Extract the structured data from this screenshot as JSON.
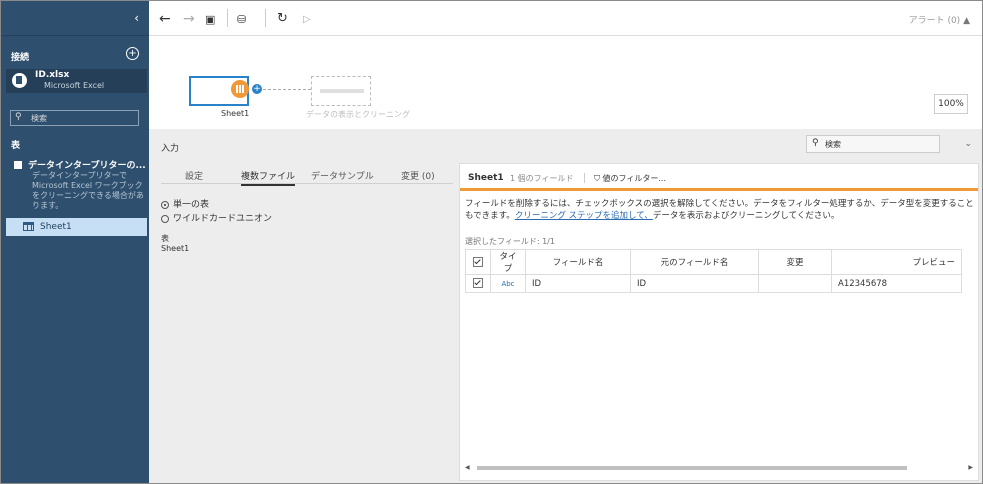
{
  "sidebar": {
    "collapse_glyph": "‹",
    "connections_label": "接続",
    "connection": {
      "name": "ID.xlsx",
      "type": "Microsoft Excel"
    },
    "search_placeholder": "検索",
    "tables_label": "表",
    "data_interpreter": {
      "label": "データインタープリターの...",
      "description": "データインタープリターで Microsoft Excel ワークブックをクリーニングできる場合があります。"
    },
    "sheet_item": "Sheet1"
  },
  "toolbar": {
    "alert": "アラート (0)"
  },
  "canvas": {
    "node_label": "Sheet1",
    "ghost_label": "データの表示とクリーニング",
    "zoom": "100%"
  },
  "panel": {
    "title": "入力",
    "search_placeholder": "検索",
    "tabs": [
      "設定",
      "複数ファイル",
      "データサンプル",
      "変更 (0)"
    ],
    "radio_single": "単一の表",
    "radio_wildcard": "ワイルドカードユニオン",
    "table_label": "表",
    "table_value": "Sheet1"
  },
  "data_panel": {
    "sheet": "Sheet1",
    "field_count": "1 個のフィールド",
    "filter_value": "値のフィルター...",
    "hint_pre": "フィールドを削除するには、チェックボックスの選択を解除してください。データをフィルター処理するか、データ型を変更することもできます。",
    "hint_link": "クリーニング ステップを追加して、",
    "hint_post": "データを表示およびクリーニングしてください。",
    "selected_fields": "選択したフィールド: 1/1",
    "columns": [
      "タイプ",
      "フィールド名",
      "元のフィールド名",
      "変更",
      "プレビュー"
    ],
    "row": {
      "type": "Abc",
      "field_name": "ID",
      "original_name": "ID",
      "change": "",
      "preview": "A12345678"
    }
  }
}
